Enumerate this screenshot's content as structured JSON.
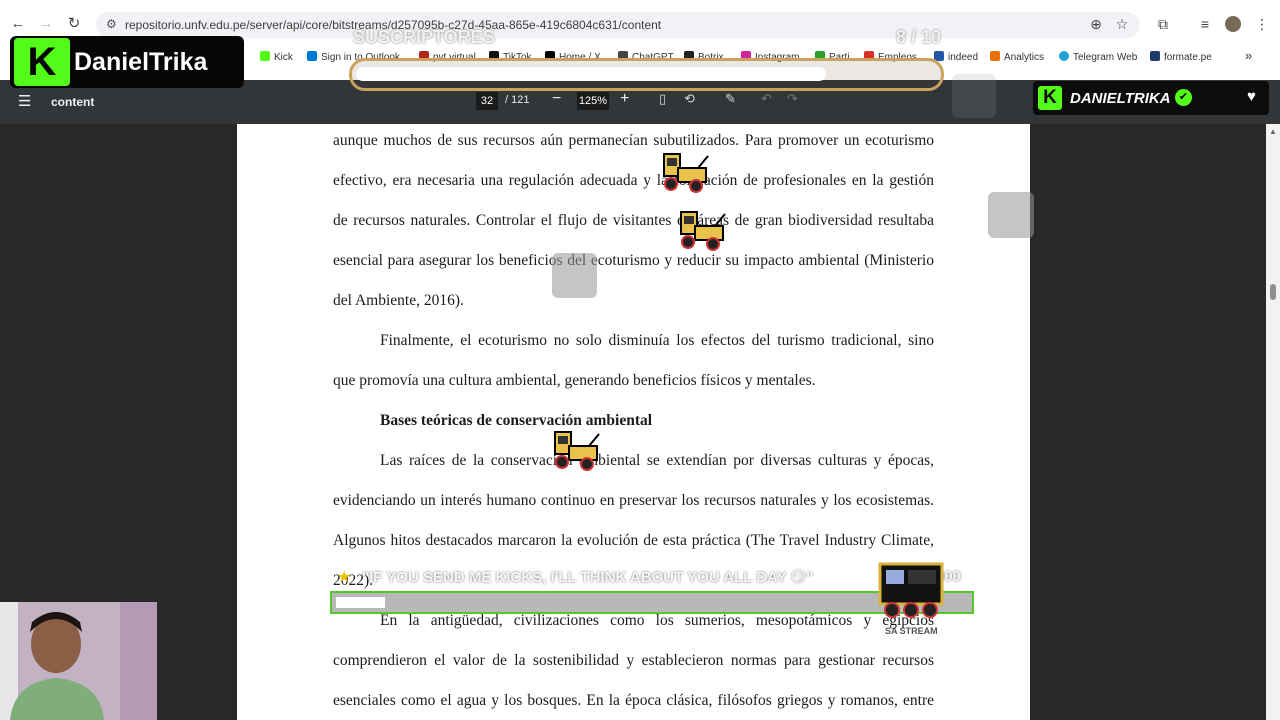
{
  "browser": {
    "url": "repositorio.unfv.edu.pe/server/api/core/bitstreams/d257095b-c27d-45aa-865e-419c6804c631/content",
    "bookmarks": [
      "Kick",
      "Sign in to Outlook",
      "pvt virtual",
      "TikTok",
      "Home / X",
      "ChatGPT",
      "Botrix",
      "Instagram",
      "Parti",
      "Empleos",
      "indeed",
      "Analytics",
      "Telegram Web",
      "formate.pe"
    ],
    "icons": [
      "back-icon",
      "forward-icon",
      "reload-icon",
      "site-info-icon",
      "zoom-icon",
      "star-icon",
      "extensions-icon",
      "media-icon",
      "profile-icon",
      "menu-icon"
    ]
  },
  "pdf_toolbar": {
    "title": "content",
    "page_current": "32",
    "page_total": "/ 121",
    "zoom": "125%",
    "zoom_out": "−",
    "zoom_in": "+"
  },
  "document": {
    "lines": [
      "aunque muchos de sus recursos aún permanecían subutilizados. Para promover un ecoturismo",
      "efectivo, era necesaria una regulación adecuada y la formación de profesionales en la gestión",
      "de recursos naturales. Controlar el flujo de visitantes en áreas de gran biodiversidad resultaba",
      "esencial para asegurar los beneficios del ecoturismo y reducir su impacto ambiental (Ministerio",
      "del Ambiente, 2016).",
      "Finalmente, el ecoturismo no solo disminuía los efectos del turismo tradicional, sino",
      "que promovía una cultura ambiental, generando beneficios físicos y mentales.",
      "Bases teóricas de conservación ambiental",
      "Las raíces de la conservación ambiental se extendían por diversas culturas y épocas,",
      "evidenciando un interés humano continuo en preservar los recursos naturales y los ecosistemas.",
      "Algunos hitos destacados marcaron la evolución de esta práctica (The Travel Industry Climate,",
      "2022).",
      "En la antigüedad, civilizaciones como los sumerios, mesopotámicos y egipcios",
      "comprendieron el valor de la sostenibilidad y establecieron normas para gestionar recursos",
      "esenciales como el agua y los bosques. En la época clásica, filósofos griegos y romanos, entre"
    ]
  },
  "overlay": {
    "brand": "DanielTrika",
    "brand_k": "K",
    "subs_label": "SUSCRIPTORES",
    "subs_count": "8 / 10",
    "subs_fraction": 0.8,
    "kick_name": "DANIELTRIKA",
    "verified": "✔",
    "heart": "♥",
    "goal_text": "\"IF YOU SEND ME KICKS, I'LL THINK ABOUT YOU ALL DAY 😏\"",
    "goal_count": "155 / 2000",
    "goal_fraction": 0.0775,
    "stream_label": "SA STREAM"
  }
}
